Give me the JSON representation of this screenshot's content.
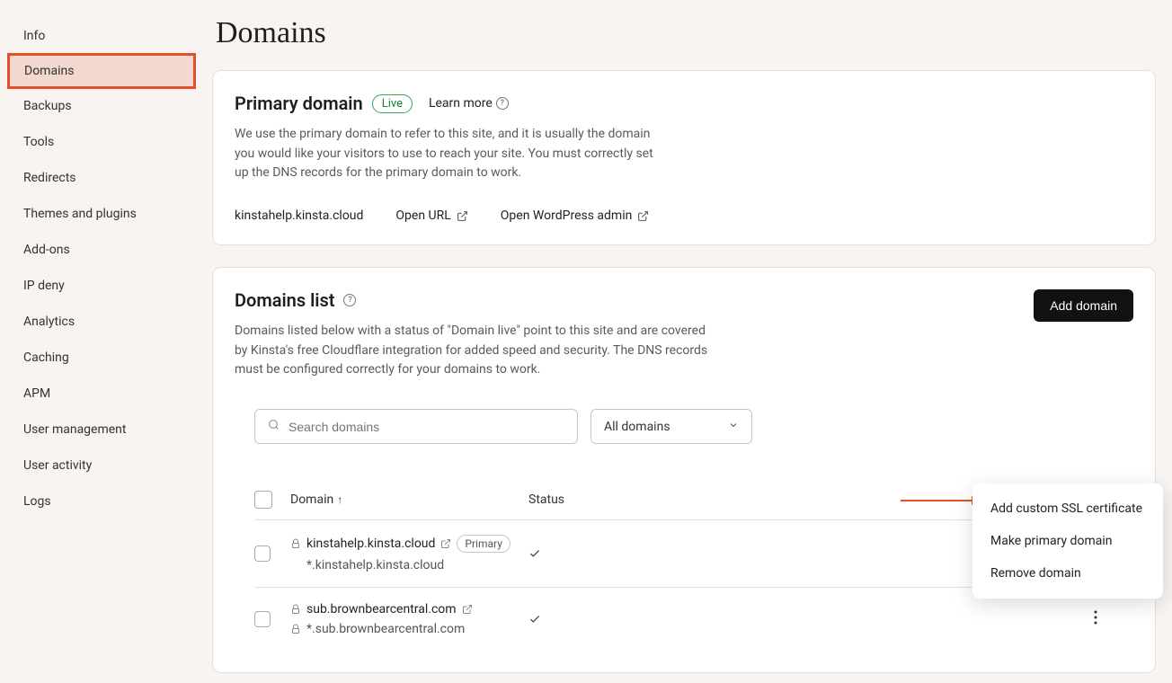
{
  "sidebar": {
    "items": [
      {
        "label": "Info",
        "active": false
      },
      {
        "label": "Domains",
        "active": true
      },
      {
        "label": "Backups",
        "active": false
      },
      {
        "label": "Tools",
        "active": false
      },
      {
        "label": "Redirects",
        "active": false
      },
      {
        "label": "Themes and plugins",
        "active": false
      },
      {
        "label": "Add-ons",
        "active": false
      },
      {
        "label": "IP deny",
        "active": false
      },
      {
        "label": "Analytics",
        "active": false
      },
      {
        "label": "Caching",
        "active": false
      },
      {
        "label": "APM",
        "active": false
      },
      {
        "label": "User management",
        "active": false
      },
      {
        "label": "User activity",
        "active": false
      },
      {
        "label": "Logs",
        "active": false
      }
    ]
  },
  "page": {
    "title": "Domains"
  },
  "primary": {
    "title": "Primary domain",
    "badge": "Live",
    "learn_more": "Learn more",
    "description": "We use the primary domain to refer to this site, and it is usually the domain you would like your visitors to use to reach your site. You must correctly set up the DNS records for the primary domain to work.",
    "domain": "kinstahelp.kinsta.cloud",
    "open_url": "Open URL",
    "open_wp": "Open WordPress admin"
  },
  "domains_list": {
    "title": "Domains list",
    "description": "Domains listed below with a status of \"Domain live\" point to this site and are covered by Kinsta's free Cloudflare integration for added speed and security. The DNS records must be configured correctly for your domains to work.",
    "add_button": "Add domain",
    "search_placeholder": "Search domains",
    "filter_selected": "All domains",
    "columns": {
      "domain": "Domain",
      "status": "Status"
    },
    "rows": [
      {
        "domain": "kinstahelp.kinsta.cloud",
        "wildcard": "*.kinstahelp.kinsta.cloud",
        "primary": true
      },
      {
        "domain": "sub.brownbearcentral.com",
        "wildcard": "*.sub.brownbearcentral.com",
        "primary": false
      }
    ]
  },
  "popup": {
    "items": [
      "Add custom SSL certificate",
      "Make primary domain",
      "Remove domain"
    ]
  },
  "badges": {
    "primary": "Primary"
  }
}
